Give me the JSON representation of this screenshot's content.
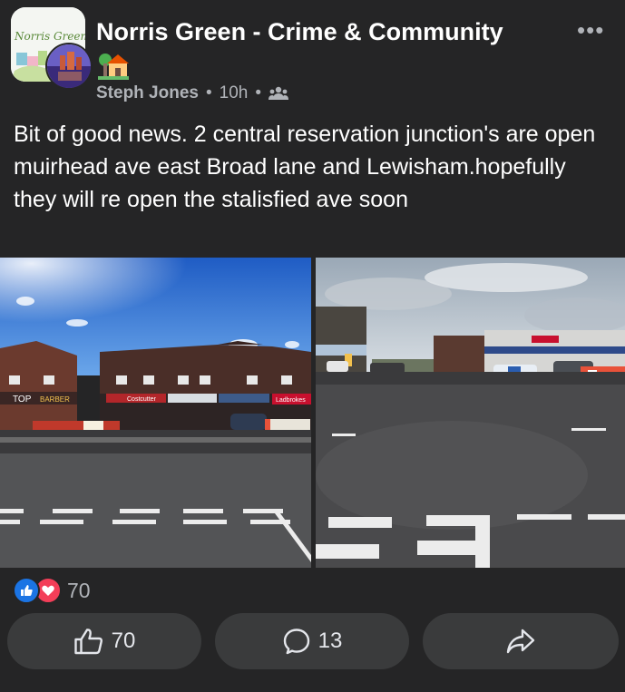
{
  "header": {
    "group_name": "Norris Green - Crime & Community",
    "group_icon_name": "group-avatar-icon",
    "group_icon_text": "Norris Green",
    "status_emoji_name": "house-with-garden-icon",
    "author": "Steph Jones",
    "time": "10h",
    "separator": "•",
    "audience_icon": "members-icon",
    "more_icon": "more-icon",
    "more_label": "•••"
  },
  "post": {
    "text": "Bit of good news. 2 central reservation junction's are open muirhead ave east Broad lane and Lewisham.hopefully they will re open the stalisfied ave soon"
  },
  "photos": [
    {
      "name": "junction-photo-left",
      "sign_texts": [
        "TOP",
        "BARBER",
        "Ladbrokes"
      ]
    },
    {
      "name": "junction-photo-right",
      "sign_texts": []
    }
  ],
  "reactions": {
    "icons": [
      "like-icon",
      "love-icon"
    ],
    "count": "70"
  },
  "actions": {
    "like_count": "70",
    "comment_count": "13",
    "like_icon": "thumbs-up-icon",
    "comment_icon": "comment-icon",
    "share_icon": "share-icon"
  },
  "colors": {
    "background": "#252526",
    "button": "#3a3b3c",
    "like_blue": "#1b74e4",
    "love_red": "#f33e58",
    "muted_text": "#b0b3b8"
  }
}
